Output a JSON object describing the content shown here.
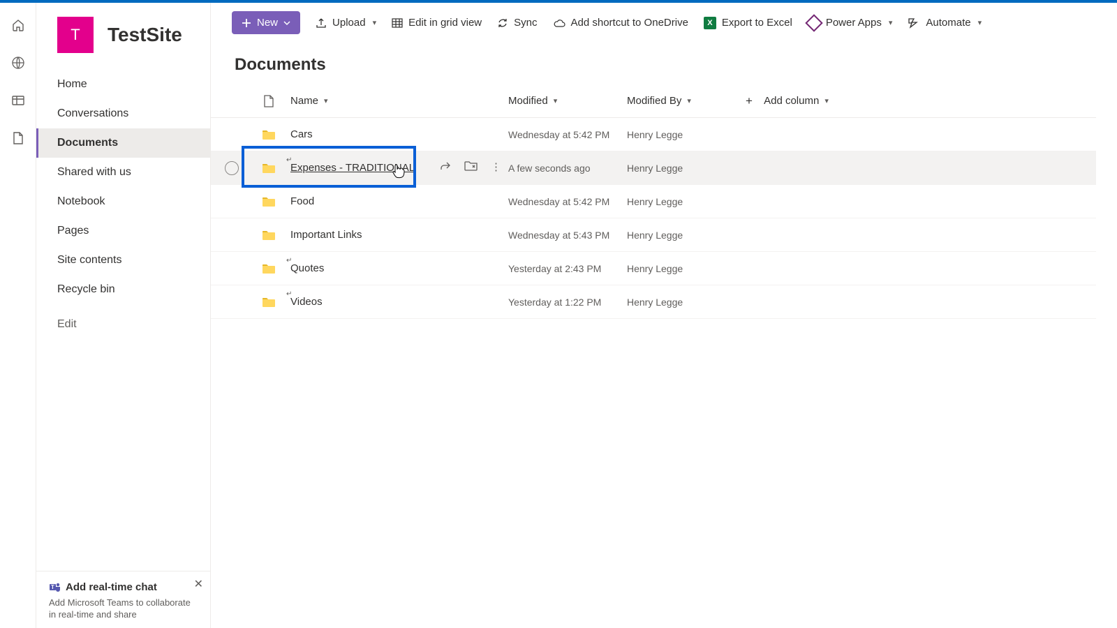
{
  "site": {
    "logo_letter": "T",
    "title": "TestSite"
  },
  "microrail": [
    "home",
    "globe",
    "grid",
    "file"
  ],
  "nav": {
    "items": [
      {
        "label": "Home"
      },
      {
        "label": "Conversations"
      },
      {
        "label": "Documents",
        "selected": true
      },
      {
        "label": "Shared with us"
      },
      {
        "label": "Notebook"
      },
      {
        "label": "Pages"
      },
      {
        "label": "Site contents"
      },
      {
        "label": "Recycle bin"
      }
    ],
    "edit_label": "Edit"
  },
  "promo": {
    "title": "Add real-time chat",
    "desc": "Add Microsoft Teams to collaborate in real-time and share"
  },
  "commandbar": {
    "new": "New",
    "upload": "Upload",
    "editgrid": "Edit in grid view",
    "sync": "Sync",
    "shortcut": "Add shortcut to OneDrive",
    "export": "Export to Excel",
    "powerapps": "Power Apps",
    "automate": "Automate"
  },
  "list": {
    "title": "Documents",
    "columns": {
      "name": "Name",
      "modified": "Modified",
      "modified_by": "Modified By",
      "add": "Add column"
    },
    "rows": [
      {
        "name": "Cars",
        "modified": "Wednesday at 5:42 PM",
        "by": "Henry Legge",
        "ret": false,
        "hover": false
      },
      {
        "name": "Expenses - TRADITIONAL",
        "modified": "A few seconds ago",
        "by": "Henry Legge",
        "ret": true,
        "hover": true,
        "highlight": true
      },
      {
        "name": "Food",
        "modified": "Wednesday at 5:42 PM",
        "by": "Henry Legge",
        "ret": false,
        "hover": false
      },
      {
        "name": "Important Links",
        "modified": "Wednesday at 5:43 PM",
        "by": "Henry Legge",
        "ret": false,
        "hover": false
      },
      {
        "name": "Quotes",
        "modified": "Yesterday at 2:43 PM",
        "by": "Henry Legge",
        "ret": true,
        "hover": false
      },
      {
        "name": "Videos",
        "modified": "Yesterday at 1:22 PM",
        "by": "Henry Legge",
        "ret": true,
        "hover": false
      }
    ]
  }
}
